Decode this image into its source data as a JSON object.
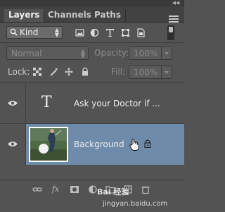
{
  "tabs": [
    {
      "label": "Layers",
      "active": true
    },
    {
      "label": "Channels",
      "active": false
    },
    {
      "label": "Paths",
      "active": false
    }
  ],
  "filter": {
    "kind_label": "Kind",
    "icons": [
      "image-filter-icon",
      "adjustment-filter-icon",
      "type-filter-icon",
      "shape-filter-icon",
      "smart-object-filter-icon"
    ]
  },
  "blend": {
    "mode": "Normal",
    "opacity_label": "Opacity:",
    "opacity_value": "100%",
    "fill_label": "Fill:",
    "fill_value": "100%"
  },
  "lock": {
    "label": "Lock:",
    "icons": [
      "lock-transparent-pixels-icon",
      "lock-image-pixels-icon",
      "lock-position-icon",
      "lock-all-icon"
    ]
  },
  "layers": [
    {
      "name": "Ask your Doctor if ...",
      "type": "text",
      "thumb_glyph": "T",
      "visible": true,
      "selected": false
    },
    {
      "name": "Background",
      "type": "image",
      "visible": true,
      "selected": true,
      "locked": true
    }
  ],
  "bottom_icons": [
    "link-layers-icon",
    "fx-icon",
    "add-mask-icon",
    "adjustment-layer-icon",
    "new-group-icon",
    "new-layer-icon",
    "delete-icon"
  ],
  "bottom_fx_label": "fx",
  "watermark": {
    "line1": "Bai 经验",
    "line2": "jingyan.baidu.com"
  },
  "colors": {
    "panel": "#535353",
    "tabbar": "#424242",
    "selected_row": "#6f8baa"
  }
}
